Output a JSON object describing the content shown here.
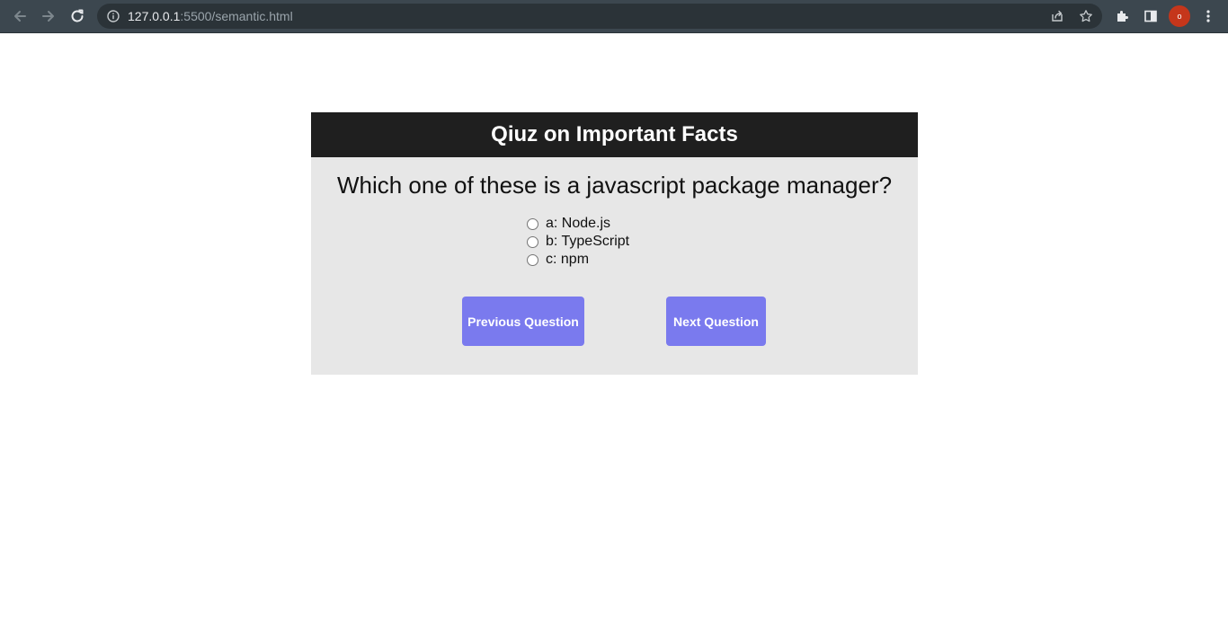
{
  "browser": {
    "url_host": "127.0.0.1",
    "url_rest": ":5500/semantic.html",
    "profile_initial": "o"
  },
  "quiz": {
    "title": "Qiuz on Important Facts",
    "question": "Which one of these is a javascript package manager?",
    "answers": [
      {
        "label": "a: Node.js"
      },
      {
        "label": "b: TypeScript"
      },
      {
        "label": "c: npm"
      }
    ],
    "prev_label": "Previous Question",
    "next_label": "Next Question"
  },
  "colors": {
    "header_bg": "#1f1f1f",
    "card_bg": "#e7e7e7",
    "button_bg": "#7a7aee",
    "chrome_bg": "#3c474f"
  }
}
